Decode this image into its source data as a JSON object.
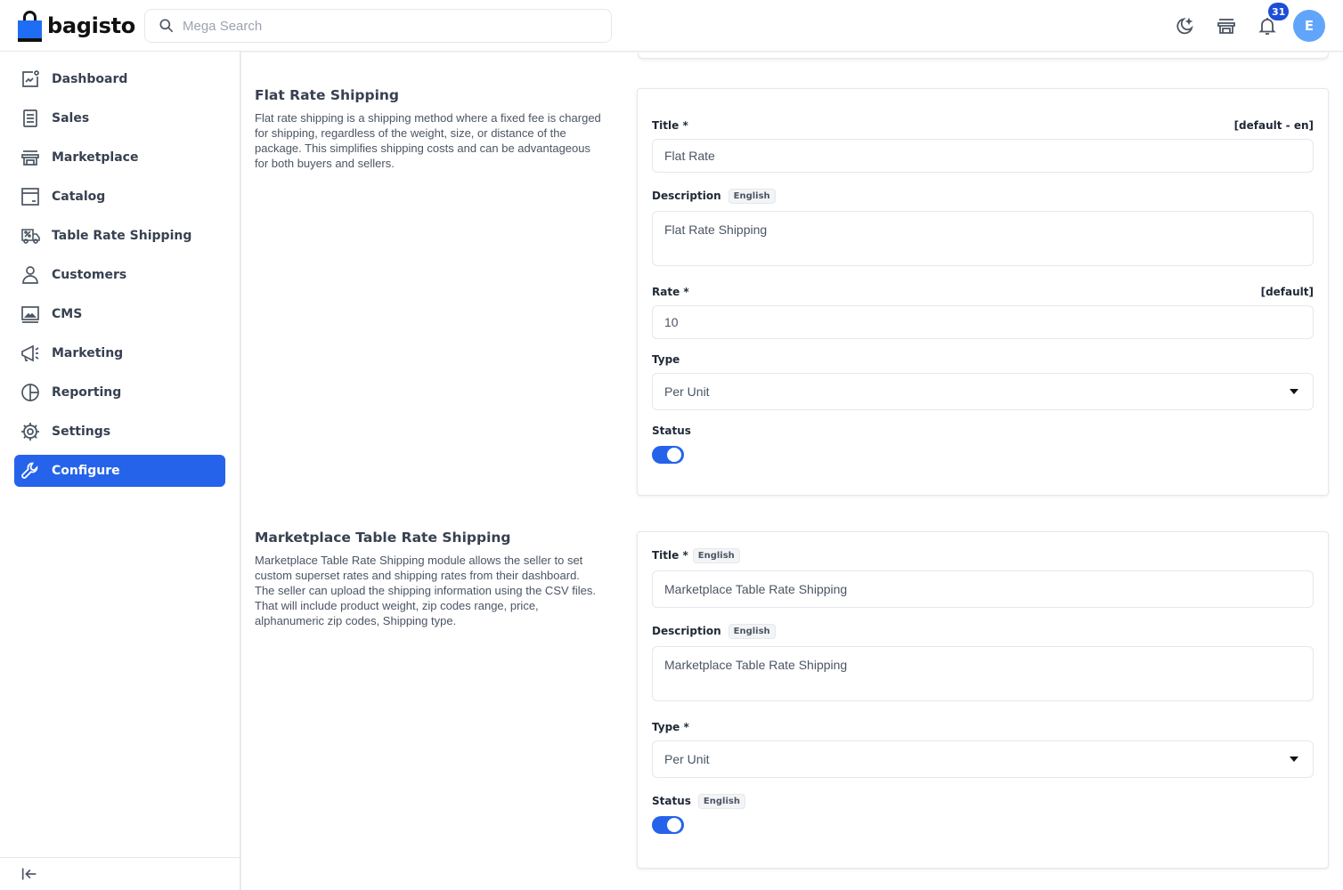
{
  "header": {
    "brand": "bagisto",
    "search_placeholder": "Mega Search",
    "notification_count": "31",
    "avatar_initial": "E",
    "icons": [
      "dark-mode-icon",
      "storefront-icon",
      "bell-icon"
    ]
  },
  "sidebar": {
    "items": [
      {
        "label": "Dashboard",
        "icon": "dashboard-icon",
        "active": false
      },
      {
        "label": "Sales",
        "icon": "sales-icon",
        "active": false
      },
      {
        "label": "Marketplace",
        "icon": "store-icon",
        "active": false
      },
      {
        "label": "Catalog",
        "icon": "catalog-icon",
        "active": false
      },
      {
        "label": "Table Rate Shipping",
        "icon": "truck-icon",
        "active": false
      },
      {
        "label": "Customers",
        "icon": "user-icon",
        "active": false
      },
      {
        "label": "CMS",
        "icon": "cms-icon",
        "active": false
      },
      {
        "label": "Marketing",
        "icon": "megaphone-icon",
        "active": false
      },
      {
        "label": "Reporting",
        "icon": "pie-chart-icon",
        "active": false
      },
      {
        "label": "Settings",
        "icon": "gear-icon",
        "active": false
      },
      {
        "label": "Configure",
        "icon": "wrench-icon",
        "active": true
      }
    ],
    "collapse_icon": "collapse-sidebar-icon"
  },
  "sections": {
    "flat_rate": {
      "title": "Flat Rate Shipping",
      "description": "Flat rate shipping is a shipping method where a fixed fee is charged for shipping, regardless of the weight, size, or distance of the package. This simplifies shipping costs and can be advantageous for both buyers and sellers.",
      "title_label": "Title *",
      "title_scope": "[default - en]",
      "title_value": "Flat Rate",
      "description_label": "Description",
      "description_lang": "English",
      "description_value": "Flat Rate Shipping",
      "rate_label": "Rate *",
      "rate_scope": "[default]",
      "rate_value": "10",
      "type_label": "Type",
      "type_value": "Per Unit",
      "status_label": "Status",
      "status_on": true
    },
    "marketplace_table_rate": {
      "title": "Marketplace Table Rate Shipping",
      "description": "Marketplace Table Rate Shipping module allows the seller to set custom superset rates and shipping rates from their dashboard. The seller can upload the shipping information using the CSV files. That will include product weight, zip codes range, price, alphanumeric zip codes, Shipping type.",
      "title_label": "Title *",
      "title_lang": "English",
      "title_value": "Marketplace Table Rate Shipping",
      "description_label": "Description",
      "description_lang": "English",
      "description_value": "Marketplace Table Rate Shipping",
      "type_label": "Type *",
      "type_value": "Per Unit",
      "status_label": "Status",
      "status_lang": "English",
      "status_on": true
    }
  },
  "colors": {
    "accent": "#2563eb",
    "brand_bag": "#1d6ef5",
    "avatar": "#60a5fa"
  }
}
